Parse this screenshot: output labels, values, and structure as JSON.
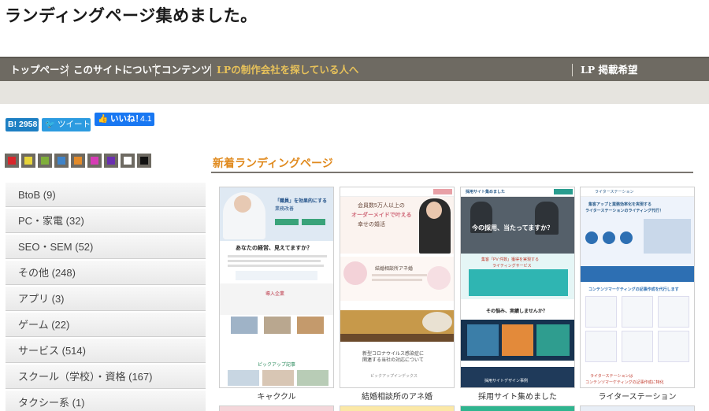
{
  "site": {
    "title": "ランディングページ集めました。"
  },
  "nav": {
    "items": [
      {
        "label": "トップページ",
        "active": false
      },
      {
        "label": "このサイトについて",
        "active": false
      },
      {
        "label": "コンテンツ",
        "active": false
      },
      {
        "label": "LPの制作会社を探している人へ",
        "active": true
      }
    ],
    "right_label": "LP 掲載希望"
  },
  "share": {
    "hatena_count": "B! 2958",
    "tweet_label": "ツイート",
    "like_label": "いいね！",
    "like_count": "4.1"
  },
  "colors": {
    "swatches": [
      "#d9262b",
      "#e7d43a",
      "#7fae3a",
      "#3f83c8",
      "#e38b2a",
      "#d63cb5",
      "#6a2fb0",
      "#ffffff",
      "#111111"
    ],
    "nav_bg": "#6e6a62",
    "accent": "#e08a1e"
  },
  "sidebar": {
    "categories": [
      "BtoB (9)",
      "PC・家電 (32)",
      "SEO・SEM (52)",
      "その他 (248)",
      "アプリ (3)",
      "ゲーム (22)",
      "サービス (514)",
      "スクール（学校）・資格 (167)",
      "タクシー系 (1)"
    ]
  },
  "main": {
    "section_title": "新着ランディングページ",
    "cards": [
      {
        "label": "キャククル",
        "hero_line1": "「職員」を効果的にする",
        "hero_line2": "業務改善",
        "heading": "あなたの経営、見えてますか？",
        "section2": "導入企業",
        "section3": "ピックアップ記事"
      },
      {
        "label": "結婚相談所のアネ婚",
        "hero_line1": "会員数5万人以上の",
        "hero_line2": "オーダーメイドで叶える",
        "hero_line3": "幸せの婚活",
        "heading": "結婚相談所アネ婚",
        "footer_line1": "新型コロナウイルス感染症に",
        "footer_line2": "関連する当社の対応について",
        "footer_line3": "ピックアップインデックス"
      },
      {
        "label": "採用サイト集めました",
        "brand": "採用サイト集めました",
        "hero": "今の採用、当たってますか？",
        "banner_line1": "集客「PV 件数」獲得を実現する",
        "banner_line2": "ライティングサービス",
        "heading": "その悩み、実績しませんか？",
        "footer": "採用サイトデザイン事例"
      },
      {
        "label": "ライターステーション",
        "brand": "ライターステーション",
        "hero_line1": "集客アップと業務効率化を実現する",
        "hero_line2": "ライターステーションのライティング代行！",
        "heading": "コンテンツマーケティングの記事作成を代行します",
        "footer_line1": "ライターステーションは",
        "footer_line2": "コンテンツマーケティングの記事作成に特化"
      }
    ]
  }
}
